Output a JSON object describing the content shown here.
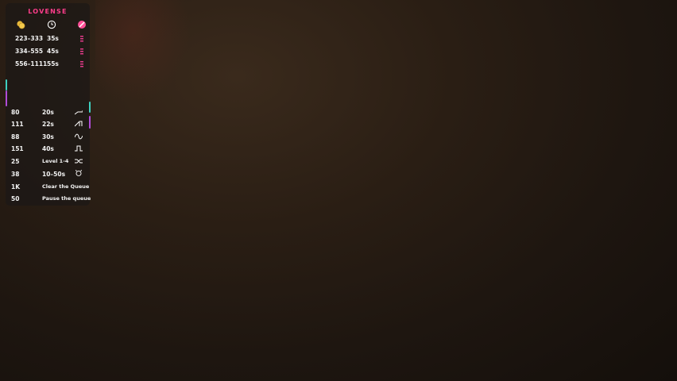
{
  "brand": "LOVENSE",
  "colors": {
    "brand_pink": "#ff3d8b",
    "accent_teal": "#3fd0c0",
    "accent_purple": "#b04cd8"
  },
  "header_icons": [
    "coin-icon",
    "clock-icon",
    "ban-icon"
  ],
  "ranges": [
    {
      "tokens": "223–333",
      "duration": "35s"
    },
    {
      "tokens": "334–555",
      "duration": "45s"
    },
    {
      "tokens": "556–1111",
      "duration": "55s"
    }
  ],
  "patterns": [
    {
      "tokens": "80",
      "label": "20s",
      "icon": "ramp-icon"
    },
    {
      "tokens": "111",
      "label": "22s",
      "icon": "sawtooth-icon"
    },
    {
      "tokens": "88",
      "label": "30s",
      "icon": "wave-icon"
    },
    {
      "tokens": "151",
      "label": "40s",
      "icon": "pulse-icon"
    },
    {
      "tokens": "25",
      "label": "Level 1-4",
      "icon": "random-icon"
    },
    {
      "tokens": "38",
      "label": "10–50s",
      "icon": "surprise-icon"
    },
    {
      "tokens": "1K",
      "label": "Clear the Queue",
      "icon": ""
    },
    {
      "tokens": "50",
      "label": "Pause the queue",
      "icon": ""
    }
  ]
}
